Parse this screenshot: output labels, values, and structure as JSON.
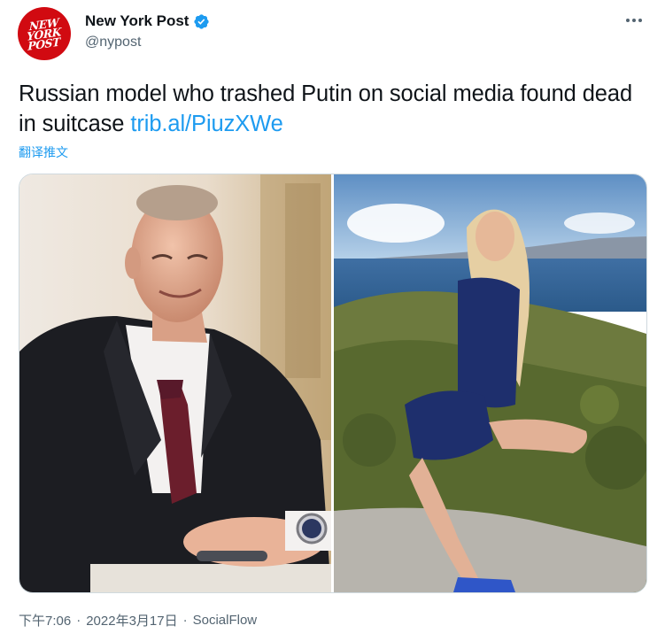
{
  "author": {
    "avatar_text": "NEW YORK POST",
    "display_name": "New York Post",
    "handle": "@nypost",
    "verified": true
  },
  "tweet": {
    "text": "Russian model who trashed Putin on social media found dead in suitcase",
    "link": "trib.al/PiuzXWe",
    "translate_label": "翻译推文"
  },
  "media": {
    "count": 2
  },
  "meta": {
    "time": "下午7:06",
    "date": "2022年3月17日",
    "separator": "·",
    "source": "SocialFlow"
  },
  "colors": {
    "link": "#1d9bf0",
    "secondary_text": "#536471",
    "avatar_bg": "#d10a11"
  },
  "icons": [
    "verified-badge-icon",
    "more-options-icon"
  ]
}
